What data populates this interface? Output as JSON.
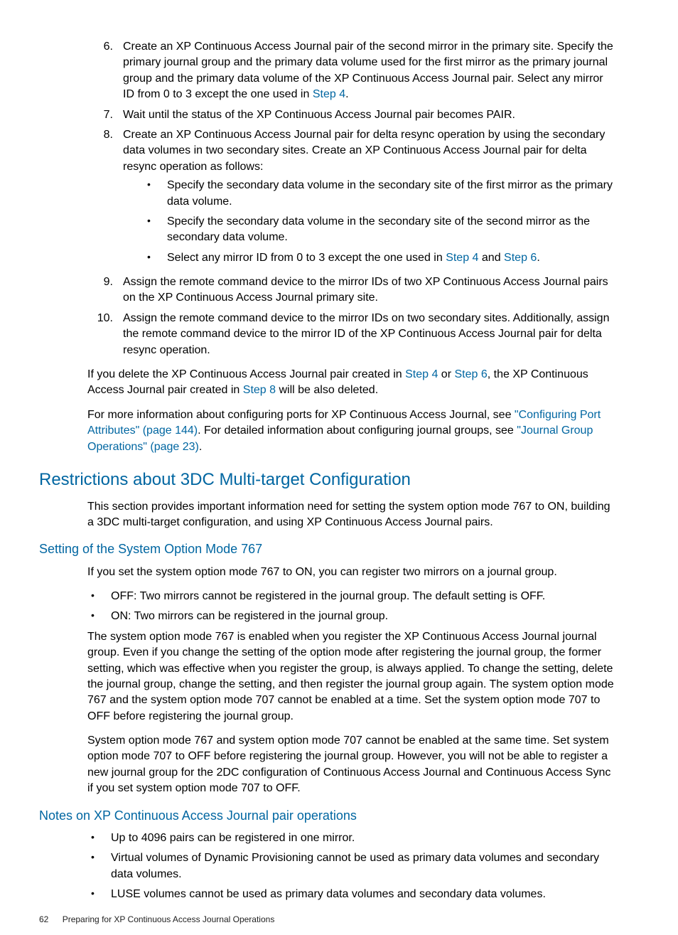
{
  "steps": {
    "s6": {
      "num": "6.",
      "text_a": "Create an XP Continuous Access Journal pair of the second mirror in the primary site. Specify the primary journal group and the primary data volume used for the first mirror as the primary journal group and the primary data volume of the XP Continuous Access Journal pair. Select any mirror ID from 0 to 3 except the one used in ",
      "link": "Step 4",
      "text_b": "."
    },
    "s7": {
      "num": "7.",
      "text": "Wait until the status of the XP Continuous Access Journal pair becomes PAIR."
    },
    "s8": {
      "num": "8.",
      "text": "Create an XP Continuous Access Journal pair for delta resync operation by using the secondary data volumes in two secondary sites. Create an XP Continuous Access Journal pair for delta resync operation as follows:",
      "bullets": {
        "b1": "Specify the secondary data volume in the secondary site of the first mirror as the primary data volume.",
        "b2": "Specify the secondary data volume in the secondary site of the second mirror as the secondary data volume.",
        "b3_a": "Select any mirror ID from 0 to 3 except the one used in ",
        "b3_link1": "Step 4",
        "b3_mid": " and ",
        "b3_link2": "Step 6",
        "b3_end": "."
      }
    },
    "s9": {
      "num": "9.",
      "text": "Assign the remote command device to the mirror IDs of two XP Continuous Access Journal pairs on the XP Continuous Access Journal primary site."
    },
    "s10": {
      "num": "10.",
      "text": "Assign the remote command device to the mirror IDs on two secondary sites. Additionally, assign the remote command device to the mirror ID of the XP Continuous Access Journal pair for delta resync operation."
    }
  },
  "para1": {
    "a": "If you delete the XP Continuous Access Journal pair created in ",
    "l1": "Step 4",
    "b": " or ",
    "l2": "Step 6",
    "c": ", the XP Continuous Access Journal pair created in ",
    "l3": "Step 8",
    "d": " will be also deleted."
  },
  "para2": {
    "a": "For more information about configuring ports for XP Continuous Access Journal, see ",
    "l1": "\"Configuring Port Attributes\" (page 144)",
    "b": ". For detailed information about configuring journal groups, see ",
    "l2": "\"Journal Group Operations\" (page 23)",
    "c": "."
  },
  "h2": "Restrictions about 3DC Multi-target Configuration",
  "h2_intro": "This section provides important information need for setting the system option mode 767 to ON, building a 3DC multi-target configuration, and using XP Continuous Access Journal pairs.",
  "h3a": "Setting of the System Option Mode 767",
  "h3a_intro": "If you set the system option mode 767 to ON, you can register two mirrors on a journal group.",
  "h3a_bullets": {
    "b1": "OFF: Two mirrors cannot be registered in the journal group. The default setting is OFF.",
    "b2": "ON: Two mirrors can be registered in the journal group."
  },
  "h3a_p2": "The system option mode 767 is enabled when you register the XP Continuous Access Journal journal group. Even if you change the setting of the option mode after registering the journal group, the former setting, which was effective when you register the group, is always applied. To change the setting, delete the journal group, change the setting, and then register the journal group again. The system option mode 767 and the system option mode 707 cannot be enabled at a time. Set the system option mode 707 to OFF before registering the journal group.",
  "h3a_p3": "System option mode 767 and system option mode 707 cannot be enabled at the same time. Set system option mode 707 to OFF before registering the journal group. However, you will not be able to register a new journal group for the 2DC configuration of Continuous Access Journal and Continuous Access Sync if you set system option mode 707 to OFF.",
  "h3b": "Notes on XP Continuous Access Journal pair operations",
  "h3b_bullets": {
    "b1": "Up to 4096 pairs can be registered in one mirror.",
    "b2": "Virtual volumes of Dynamic Provisioning cannot be used as primary data volumes and secondary data volumes.",
    "b3": "LUSE volumes cannot be used as primary data volumes and secondary data volumes."
  },
  "footer": {
    "page": "62",
    "title": "Preparing for XP Continuous Access Journal Operations"
  }
}
